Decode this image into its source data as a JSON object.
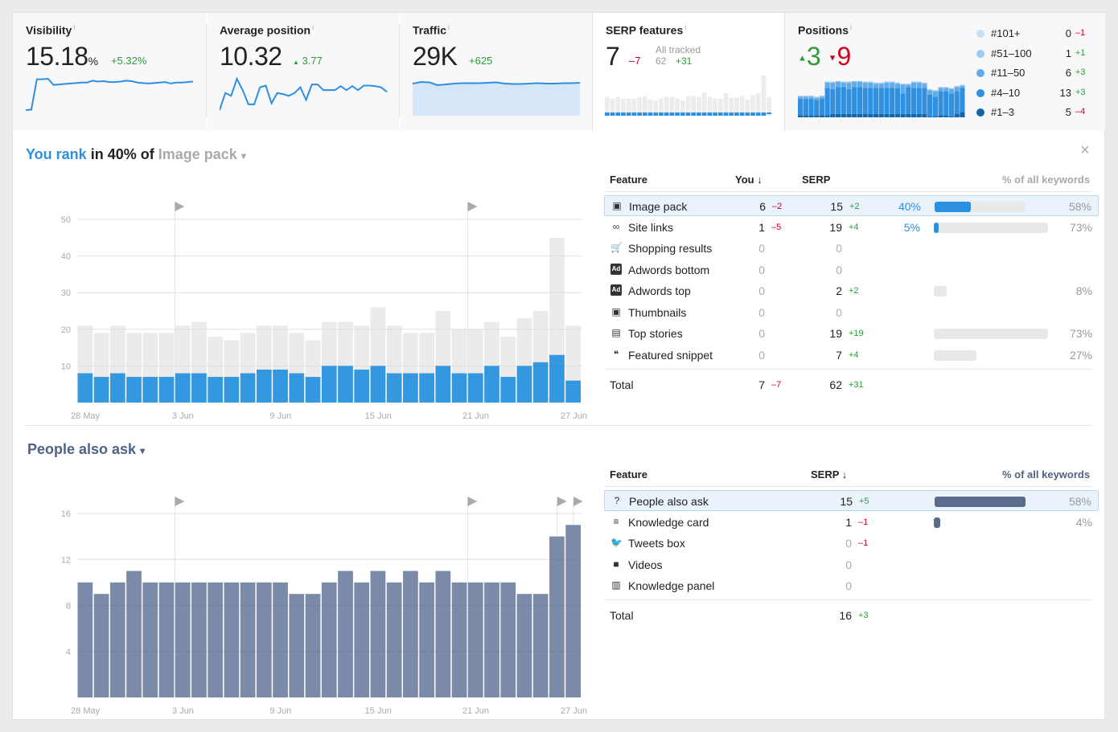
{
  "metrics": {
    "visibility": {
      "title": "Visibility",
      "info": "i",
      "value": "15.18",
      "unit": "%",
      "delta": "+5.32%",
      "spark": [
        30,
        31,
        95,
        95,
        96,
        83,
        84,
        85,
        86,
        87,
        88,
        88,
        92,
        90,
        91,
        89,
        89,
        90,
        92,
        91,
        88,
        87,
        86,
        87,
        88,
        89,
        86,
        88,
        88,
        89,
        90
      ]
    },
    "avg_position": {
      "title": "Average position",
      "info": "i",
      "value": "10.32",
      "delta_arrow": "▲",
      "delta": "3.77",
      "spark": [
        0,
        30,
        25,
        55,
        35,
        10,
        10,
        40,
        43,
        12,
        30,
        28,
        25,
        30,
        40,
        18,
        45,
        45,
        35,
        35,
        35,
        42,
        35,
        42,
        35,
        43,
        43,
        42,
        40,
        32
      ]
    },
    "traffic": {
      "title": "Traffic",
      "info": "i",
      "value": "29K",
      "delta": "+625",
      "spark": [
        88,
        92,
        91,
        84,
        86,
        88,
        89,
        89,
        89,
        90,
        91,
        88,
        87,
        87,
        88,
        89,
        88,
        88,
        89,
        89,
        90
      ]
    },
    "serp_features": {
      "title": "SERP features",
      "info": "i",
      "value": "7",
      "delta": "–7",
      "all_tracked_label": "All tracked",
      "all_tracked_value": "62",
      "all_tracked_delta": "+31",
      "spark_total": [
        21,
        19,
        21,
        19,
        19,
        19,
        21,
        22,
        18,
        17,
        19,
        21,
        21,
        19,
        17,
        22,
        22,
        21,
        26,
        21,
        19,
        19,
        25,
        20,
        20,
        22,
        18,
        23,
        25,
        45,
        21
      ],
      "spark_you": [
        8,
        7,
        8,
        7,
        7,
        7,
        8,
        8,
        7,
        7,
        8,
        9,
        9,
        8,
        7,
        10,
        10,
        9,
        10,
        8,
        8,
        8,
        10,
        8,
        8,
        10,
        7,
        10,
        11,
        13,
        6
      ]
    },
    "positions": {
      "title": "Positions",
      "info": "i",
      "up_arrow": "▲",
      "up": "3",
      "down_arrow": "▼",
      "down": "9",
      "legend": [
        {
          "label": "#101+",
          "value": "0",
          "delta": "–1",
          "color": "#c6e1f7",
          "dir": "down"
        },
        {
          "label": "#51–100",
          "value": "1",
          "delta": "+1",
          "color": "#9dcbf1",
          "dir": "up"
        },
        {
          "label": "#11–50",
          "value": "6",
          "delta": "+3",
          "color": "#62acea",
          "dir": "up"
        },
        {
          "label": "#4–10",
          "value": "13",
          "delta": "+3",
          "color": "#2f8fe0",
          "dir": "up"
        },
        {
          "label": "#1–3",
          "value": "5",
          "delta": "–4",
          "color": "#1565a8",
          "dir": "down"
        }
      ],
      "spark_top3": [
        2,
        2,
        2,
        2,
        2,
        2,
        3,
        3,
        3,
        3,
        3,
        3,
        3,
        3,
        3,
        3,
        3,
        3,
        3,
        3,
        3,
        3,
        3,
        3,
        1,
        1,
        2,
        2,
        1,
        3,
        5
      ],
      "spark_4_10": [
        15,
        15,
        15,
        14,
        15,
        25,
        23,
        25,
        25,
        23,
        25,
        25,
        24,
        24,
        24,
        24,
        24,
        24,
        24,
        19,
        25,
        24,
        24,
        24,
        20,
        18,
        22,
        22,
        21,
        21,
        22
      ],
      "spark_11_50": [
        2,
        2,
        2,
        2,
        2,
        5,
        6,
        5,
        4,
        6,
        5,
        5,
        5,
        5,
        4,
        4,
        5,
        5,
        4,
        8,
        2,
        5,
        5,
        4,
        4,
        5,
        3,
        3,
        4,
        4,
        2
      ],
      "spark_51_100": [
        1,
        1,
        1,
        1,
        1,
        1,
        1,
        1,
        1,
        1,
        1,
        1,
        1,
        1,
        1,
        1,
        1,
        1,
        1,
        1,
        1,
        1,
        1,
        1,
        1,
        1,
        1,
        1,
        1,
        1,
        1
      ]
    }
  },
  "section1": {
    "title_highlight": "You rank",
    "title_mid": "in 40% of",
    "title_feature": "Image pack",
    "dropdown_icon": "▾",
    "close_icon": "×",
    "table": {
      "headers": {
        "feature": "Feature",
        "you": "You",
        "you_sort": "↓",
        "serp": "SERP",
        "pct": "% of all keywords"
      },
      "rows": [
        {
          "icon": "image-pack-icon",
          "glyph": "▣",
          "name": "Image pack",
          "you": "6",
          "you_delta": "–2",
          "you_dir": "down",
          "serp": "15",
          "serp_delta": "+2",
          "serp_dir": "up",
          "you_pct": "40%",
          "you_share": 40,
          "pct": "58%",
          "share": 58,
          "highlight": true
        },
        {
          "icon": "link-icon",
          "glyph": "∞",
          "name": "Site links",
          "you": "1",
          "you_delta": "–5",
          "you_dir": "down",
          "serp": "19",
          "serp_delta": "+4",
          "serp_dir": "up",
          "you_pct": "5%",
          "you_share": 5,
          "pct": "73%",
          "share": 73
        },
        {
          "icon": "cart-icon",
          "glyph": "🛒",
          "name": "Shopping results",
          "you": "0",
          "serp": "0"
        },
        {
          "icon": "ad-bottom-icon",
          "glyph": "Ad",
          "name": "Adwords bottom",
          "you": "0",
          "serp": "0"
        },
        {
          "icon": "ad-top-icon",
          "glyph": "Ad",
          "name": "Adwords top",
          "you": "0",
          "serp": "2",
          "serp_delta": "+2",
          "serp_dir": "up",
          "pct": "8%",
          "share": 8
        },
        {
          "icon": "thumbnail-icon",
          "glyph": "▣",
          "name": "Thumbnails",
          "you": "0",
          "serp": "0"
        },
        {
          "icon": "news-icon",
          "glyph": "▤",
          "name": "Top stories",
          "you": "0",
          "serp": "19",
          "serp_delta": "+19",
          "serp_dir": "up",
          "pct": "73%",
          "share": 73
        },
        {
          "icon": "quote-icon",
          "glyph": "❝",
          "name": "Featured snippet",
          "you": "0",
          "serp": "7",
          "serp_delta": "+4",
          "serp_dir": "up",
          "pct": "27%",
          "share": 27
        }
      ],
      "total": {
        "label": "Total",
        "you": "7",
        "you_delta": "–7",
        "serp": "62",
        "serp_delta": "+31"
      }
    }
  },
  "section2": {
    "title": "People also ask",
    "dropdown_icon": "▾",
    "table": {
      "headers": {
        "feature": "Feature",
        "serp": "SERP",
        "serp_sort": "↓",
        "pct": "% of all keywords"
      },
      "rows": [
        {
          "icon": "question-icon",
          "glyph": "?",
          "name": "People also ask",
          "serp": "15",
          "serp_delta": "+5",
          "serp_dir": "up",
          "pct": "58%",
          "share": 58,
          "highlight": true
        },
        {
          "icon": "knowledge-card-icon",
          "glyph": "≡",
          "name": "Knowledge card",
          "serp": "1",
          "serp_delta": "–1",
          "serp_dir": "down",
          "pct": "4%",
          "share": 4
        },
        {
          "icon": "twitter-icon",
          "glyph": "🐦",
          "name": "Tweets box",
          "serp": "0",
          "serp_delta": "–1",
          "serp_dir": "down"
        },
        {
          "icon": "video-icon",
          "glyph": "■",
          "name": "Videos",
          "serp": "0"
        },
        {
          "icon": "knowledge-panel-icon",
          "glyph": "▥",
          "name": "Knowledge panel",
          "serp": "0"
        }
      ],
      "total": {
        "label": "Total",
        "serp": "16",
        "serp_delta": "+3"
      }
    }
  },
  "chart_data": [
    {
      "type": "bar",
      "title": "Image pack",
      "x": [
        "28 May",
        "29 May",
        "30 May",
        "31 May",
        "1 Jun",
        "2 Jun",
        "3 Jun",
        "4 Jun",
        "5 Jun",
        "6 Jun",
        "7 Jun",
        "8 Jun",
        "9 Jun",
        "10 Jun",
        "11 Jun",
        "12 Jun",
        "13 Jun",
        "14 Jun",
        "15 Jun",
        "16 Jun",
        "17 Jun",
        "18 Jun",
        "19 Jun",
        "20 Jun",
        "21 Jun",
        "22 Jun",
        "23 Jun",
        "24 Jun",
        "25 Jun",
        "26 Jun",
        "27 Jun"
      ],
      "tick_labels": [
        "28 May",
        "3 Jun",
        "9 Jun",
        "15 Jun",
        "21 Jun",
        "27 Jun"
      ],
      "series": [
        {
          "name": "SERP",
          "color": "#ebebeb",
          "values": [
            21,
            19,
            21,
            19,
            19,
            19,
            21,
            22,
            18,
            17,
            19,
            21,
            21,
            19,
            17,
            22,
            22,
            21,
            26,
            21,
            19,
            19,
            25,
            20,
            20,
            22,
            18,
            23,
            25,
            45,
            21
          ]
        },
        {
          "name": "You",
          "color": "#3498e0",
          "values": [
            8,
            7,
            8,
            7,
            7,
            7,
            8,
            8,
            7,
            7,
            8,
            9,
            9,
            8,
            7,
            10,
            10,
            9,
            10,
            8,
            8,
            8,
            10,
            8,
            8,
            10,
            7,
            10,
            11,
            13,
            6
          ]
        }
      ],
      "yticks": [
        10,
        20,
        30,
        40,
        50
      ],
      "ylim": [
        0,
        50
      ],
      "annotations": [
        "3 Jun",
        "21 Jun"
      ],
      "grid": true
    },
    {
      "type": "bar",
      "title": "People also ask",
      "x": [
        "28 May",
        "29 May",
        "30 May",
        "31 May",
        "1 Jun",
        "2 Jun",
        "3 Jun",
        "4 Jun",
        "5 Jun",
        "6 Jun",
        "7 Jun",
        "8 Jun",
        "9 Jun",
        "10 Jun",
        "11 Jun",
        "12 Jun",
        "13 Jun",
        "14 Jun",
        "15 Jun",
        "16 Jun",
        "17 Jun",
        "18 Jun",
        "19 Jun",
        "20 Jun",
        "21 Jun",
        "22 Jun",
        "23 Jun",
        "24 Jun",
        "25 Jun",
        "26 Jun",
        "27 Jun"
      ],
      "tick_labels": [
        "28 May",
        "3 Jun",
        "9 Jun",
        "15 Jun",
        "21 Jun",
        "27 Jun"
      ],
      "series": [
        {
          "name": "SERP",
          "color": "#7a8aa8",
          "values": [
            10,
            9,
            10,
            11,
            10,
            10,
            10,
            10,
            10,
            10,
            10,
            10,
            10,
            9,
            9,
            10,
            11,
            10,
            11,
            10,
            11,
            10,
            11,
            10,
            10,
            10,
            10,
            9,
            9,
            14,
            15
          ]
        }
      ],
      "yticks": [
        4,
        8,
        12,
        16
      ],
      "ylim": [
        0,
        16
      ],
      "annotations": [
        "3 Jun",
        "21 Jun",
        "26 Jun",
        "27 Jun"
      ],
      "grid": true
    }
  ]
}
